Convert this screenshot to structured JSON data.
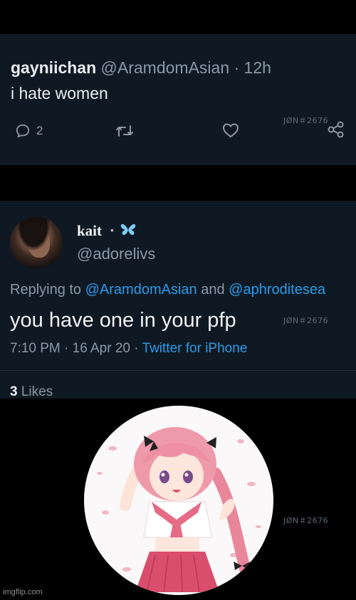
{
  "tweet1": {
    "display_name": "gayniichan",
    "handle_time": " @AramdomAsian · 12h",
    "text": "i hate women",
    "reply_count": "2",
    "watermark": "JØN＃2676"
  },
  "tweet2": {
    "display_name": "kait",
    "star": "⋆",
    "handle": "@adorelivs",
    "replying_to_label": "Replying to ",
    "mention1": "@AramdomAsian",
    "and_label": " and ",
    "mention2": "@aphroditesea",
    "text": "you have one in your pfp",
    "time_date": "7:10 PM · 16 Apr 20 · ",
    "source": "Twitter for iPhone",
    "likes_count": "3",
    "likes_label": " Likes",
    "watermark": "JØN＃2676"
  },
  "image_panel": {
    "watermark": "JØN＃2676",
    "site_label": "imgflip.com"
  },
  "colors": {
    "background": "#000000",
    "panel": "#0f1923",
    "secondary_text": "#8a99a6",
    "accent_blue": "#2b9bea"
  },
  "icons": [
    "reply-icon",
    "retweet-icon",
    "like-icon",
    "share-icon",
    "butterfly-icon"
  ]
}
